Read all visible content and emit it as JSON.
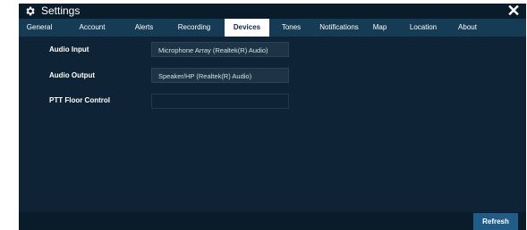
{
  "window": {
    "title": "Settings",
    "close_glyph": "✕"
  },
  "icons": {
    "settings": "gear-icon",
    "close": "close-icon"
  },
  "tabs": [
    {
      "label": "General"
    },
    {
      "label": "Account"
    },
    {
      "label": "Alerts"
    },
    {
      "label": "Recording"
    },
    {
      "label": "Devices",
      "active": true
    },
    {
      "label": "Tones"
    },
    {
      "label": "Notifications"
    },
    {
      "label": "Map"
    },
    {
      "label": "Location"
    },
    {
      "label": "About"
    }
  ],
  "devices": {
    "audio_input": {
      "label": "Audio Input",
      "value": "Microphone Array (Realtek(R) Audio)"
    },
    "audio_output": {
      "label": "Audio Output",
      "value": "Speaker/HP (Realtek(R) Audio)"
    },
    "ptt_floor_control": {
      "label": "PTT Floor Control",
      "value": ""
    }
  },
  "footer": {
    "refresh_label": "Refresh"
  },
  "colors": {
    "window_bg": "#0e2436",
    "titlebar_bg": "#0a1b29",
    "tabbar_bg": "#163b55",
    "active_tab_bg": "#ffffff",
    "button_bg": "#1f5c88"
  }
}
